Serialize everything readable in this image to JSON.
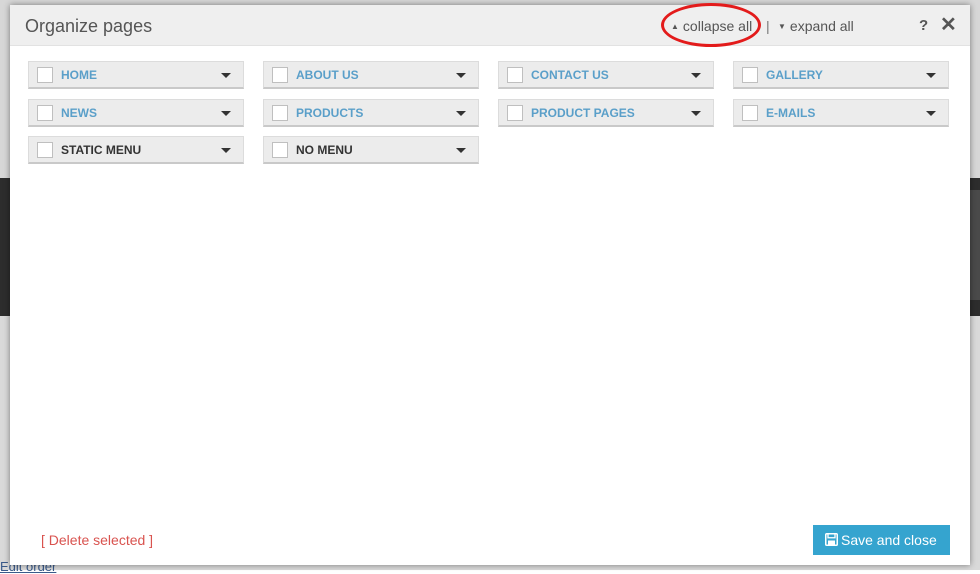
{
  "background": {
    "link_text": "Edit order"
  },
  "modal": {
    "title": "Organize pages",
    "collapse_all": "collapse all",
    "separator": "|",
    "expand_all": "expand all",
    "help": "?",
    "close": "✕"
  },
  "pages": [
    {
      "label": "HOME",
      "style": "link"
    },
    {
      "label": "ABOUT US",
      "style": "link"
    },
    {
      "label": "CONTACT US",
      "style": "link"
    },
    {
      "label": "GALLERY",
      "style": "link"
    },
    {
      "label": "NEWS",
      "style": "link"
    },
    {
      "label": "PRODUCTS",
      "style": "link"
    },
    {
      "label": "PRODUCT PAGES",
      "style": "link"
    },
    {
      "label": "E-MAILS",
      "style": "link"
    },
    {
      "label": "STATIC MENU",
      "style": "dark"
    },
    {
      "label": "NO MENU",
      "style": "dark"
    }
  ],
  "footer": {
    "delete_selected": "[ Delete selected ]",
    "save_and_close": "Save and close"
  },
  "colors": {
    "accent": "#35a4cf",
    "link_label": "#5a9fc9",
    "danger": "#d9534f",
    "highlight": "#e31b1b"
  },
  "icons": {
    "collapse": "triangle-up-icon",
    "expand": "triangle-down-icon",
    "item_caret": "caret-down-icon",
    "save": "floppy-disk-icon"
  }
}
